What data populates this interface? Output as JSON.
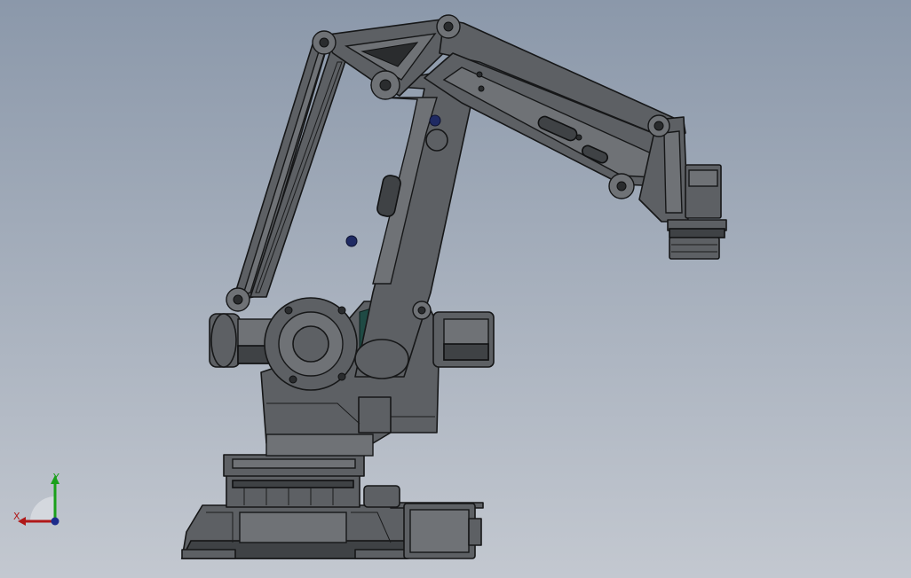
{
  "viewport": {
    "background_top": "#8b98aa",
    "background_bottom": "#c3c8d0",
    "model_color": "#5d6064",
    "accent_colors": [
      "#1f2a63",
      "#1f4a44"
    ]
  },
  "triad": {
    "x_label": "X",
    "y_label": "Y",
    "x_color": "#b01818",
    "y_color": "#1aa01a",
    "origin_color": "#1d2c8c"
  }
}
